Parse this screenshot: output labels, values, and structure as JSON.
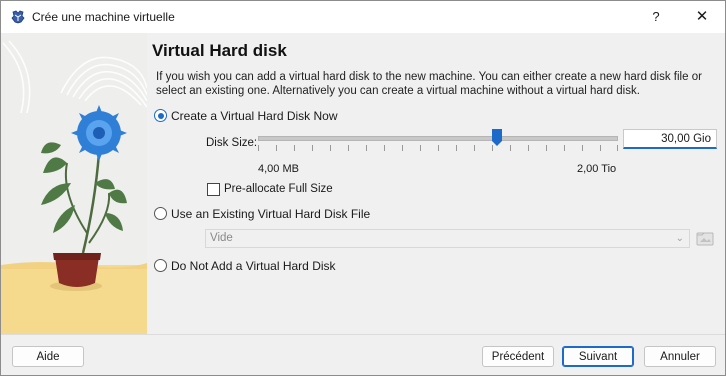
{
  "window": {
    "title": "Crée une machine virtuelle",
    "help_label": "?",
    "close_label": "✕"
  },
  "page": {
    "heading": "Virtual Hard disk",
    "description": "If you wish you can add a virtual hard disk to the new machine. You can either create a new hard disk file or select an existing one. Alternatively you can create a virtual machine without a virtual hard disk."
  },
  "options": {
    "create_now": {
      "label": "Create a Virtual Hard Disk Now",
      "selected": true
    },
    "use_existing": {
      "label": "Use an Existing Virtual Hard Disk File",
      "selected": false
    },
    "no_disk": {
      "label": "Do Not Add a Virtual Hard Disk",
      "selected": false
    }
  },
  "disk_size": {
    "label": "Disk Size:",
    "value": "30,00 Gio",
    "min_label": "4,00 MB",
    "max_label": "2,00 Tio"
  },
  "preallocate": {
    "label": "Pre-allocate Full Size",
    "checked": false
  },
  "existing_file": {
    "selected_value": "Vide"
  },
  "buttons": {
    "help": "Aide",
    "back": "Précédent",
    "next": "Suivant",
    "cancel": "Annuler"
  },
  "colors": {
    "accent": "#1e6ac9",
    "flower": "#2f7fd6",
    "pot": "#8a2d24",
    "ground": "#f5d98c"
  }
}
